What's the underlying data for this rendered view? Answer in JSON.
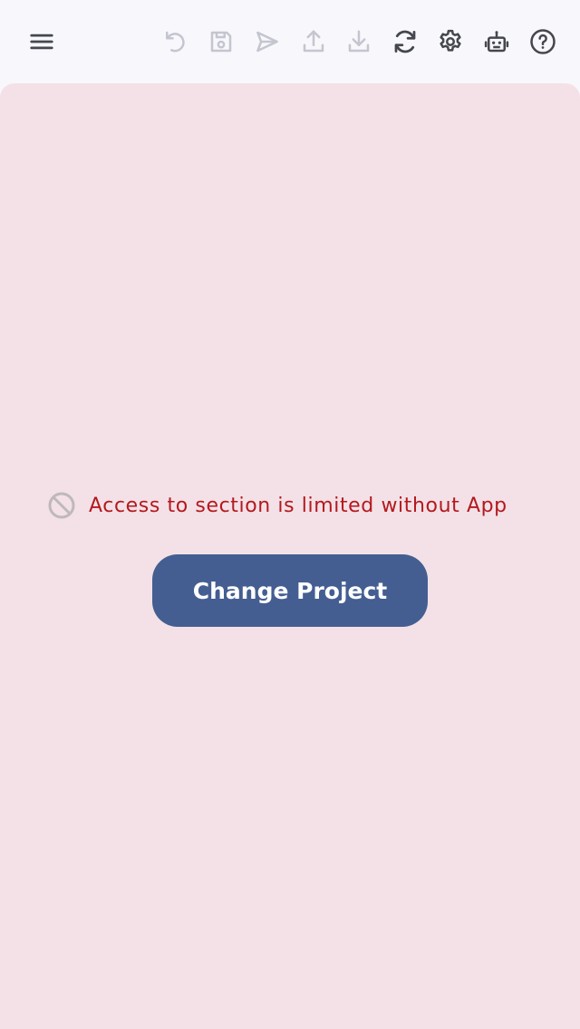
{
  "toolbar": {
    "menu_icon": "hamburger-menu-icon",
    "icons": [
      {
        "name": "undo-icon",
        "enabled": false
      },
      {
        "name": "save-icon",
        "enabled": false
      },
      {
        "name": "send-icon",
        "enabled": false
      },
      {
        "name": "upload-icon",
        "enabled": false
      },
      {
        "name": "download-icon",
        "enabled": false
      },
      {
        "name": "refresh-icon",
        "enabled": true
      },
      {
        "name": "settings-gear-icon",
        "enabled": true
      },
      {
        "name": "robot-icon",
        "enabled": true
      },
      {
        "name": "help-icon",
        "enabled": true
      }
    ]
  },
  "notice": {
    "icon": "blocked-icon",
    "text": "Access to section is limited without App"
  },
  "actions": {
    "change_project_label": "Change Project"
  },
  "colors": {
    "topbar_background": "#f8f7fc",
    "content_background": "#f3e1e7",
    "icon_enabled": "#44474e",
    "icon_disabled": "#c4c6cf",
    "notice_text": "#b3191e",
    "notice_icon": "#bfb8bd",
    "button_background": "#445e91",
    "button_text": "#ffffff"
  }
}
